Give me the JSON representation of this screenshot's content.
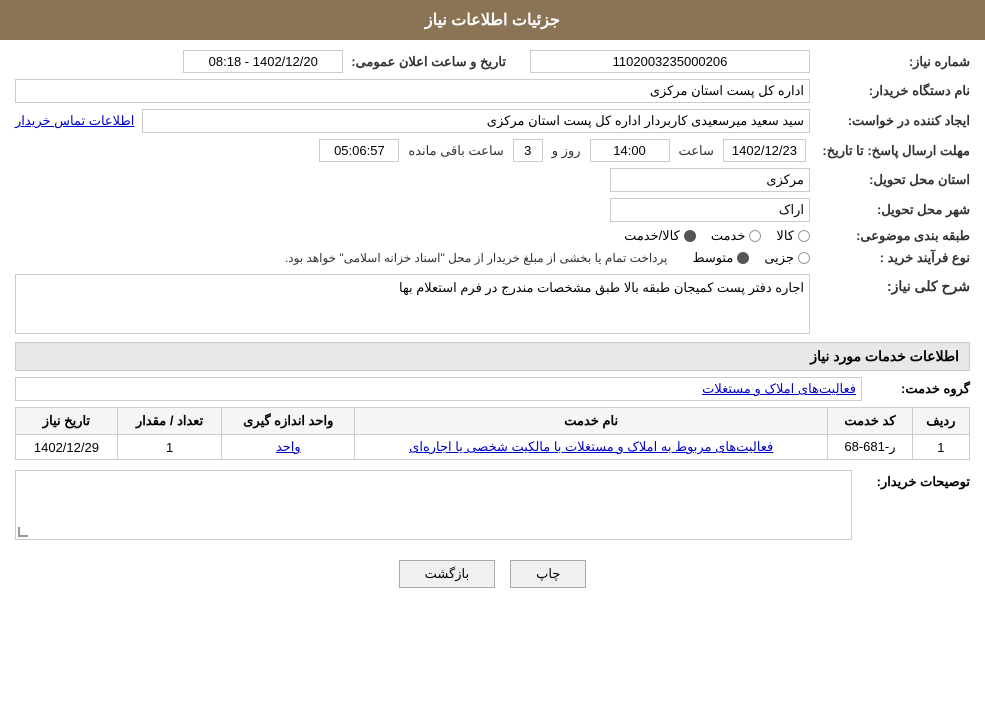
{
  "header": {
    "title": "جزئیات اطلاعات نیاز"
  },
  "fields": {
    "need_number_label": "شماره نیاز:",
    "need_number_value": "1102003235000206",
    "buyer_org_label": "نام دستگاه خریدار:",
    "buyer_org_value": "اداره کل پست استان مرکزی",
    "creator_label": "ایجاد کننده در خواست:",
    "creator_value": "سید سعید میرسعیدی کاربردار اداره کل پست استان مرکزی",
    "creator_link": "اطلاعات تماس خریدار",
    "announce_date_label": "تاریخ و ساعت اعلان عمومی:",
    "announce_date_value": "1402/12/20 - 08:18",
    "deadline_label": "مهلت ارسال پاسخ: تا تاریخ:",
    "deadline_date": "1402/12/23",
    "deadline_time_label": "ساعت",
    "deadline_time": "14:00",
    "deadline_days_label": "روز و",
    "deadline_days": "3",
    "deadline_remaining_label": "ساعت باقی مانده",
    "deadline_remaining": "05:06:57",
    "province_label": "استان محل تحویل:",
    "province_value": "مرکزی",
    "city_label": "شهر محل تحویل:",
    "city_value": "اراک",
    "category_label": "طبقه بندی موضوعی:",
    "category_options": [
      {
        "label": "کالا",
        "selected": false
      },
      {
        "label": "خدمت",
        "selected": false
      },
      {
        "label": "کالا/خدمت",
        "selected": true
      }
    ],
    "purchase_type_label": "نوع فرآیند خرید :",
    "purchase_type_options": [
      {
        "label": "جزیی",
        "selected": false
      },
      {
        "label": "متوسط",
        "selected": true
      }
    ],
    "purchase_type_note": "پرداخت تمام یا بخشی از مبلغ خریدار از محل \"اسناد خزانه اسلامی\" خواهد بود.",
    "description_section_title": "شرح کلی نیاز:",
    "description_value": "اجاره دفتر پست کمیجان طبقه بالا  طبق مشخصات مندرج در فرم استعلام بها",
    "services_section_title": "اطلاعات خدمات مورد نیاز",
    "group_service_label": "گروه خدمت:",
    "group_service_value": "فعالیت‌های  املاک و مستغلات",
    "table": {
      "headers": [
        "ردیف",
        "کد خدمت",
        "نام خدمت",
        "واحد اندازه گیری",
        "تعداد / مقدار",
        "تاریخ نیاز"
      ],
      "rows": [
        {
          "row": "1",
          "code": "ر-681-68",
          "service": "فعالیت‌های مربوط به املاک و مستغلات با مالکیت شخصی یا اجاره‌ای",
          "unit": "واحد",
          "quantity": "1",
          "date": "1402/12/29"
        }
      ]
    },
    "buyer_notes_label": "توصیحات خریدار:",
    "buyer_notes_value": ""
  },
  "buttons": {
    "print_label": "چاپ",
    "back_label": "بازگشت"
  }
}
